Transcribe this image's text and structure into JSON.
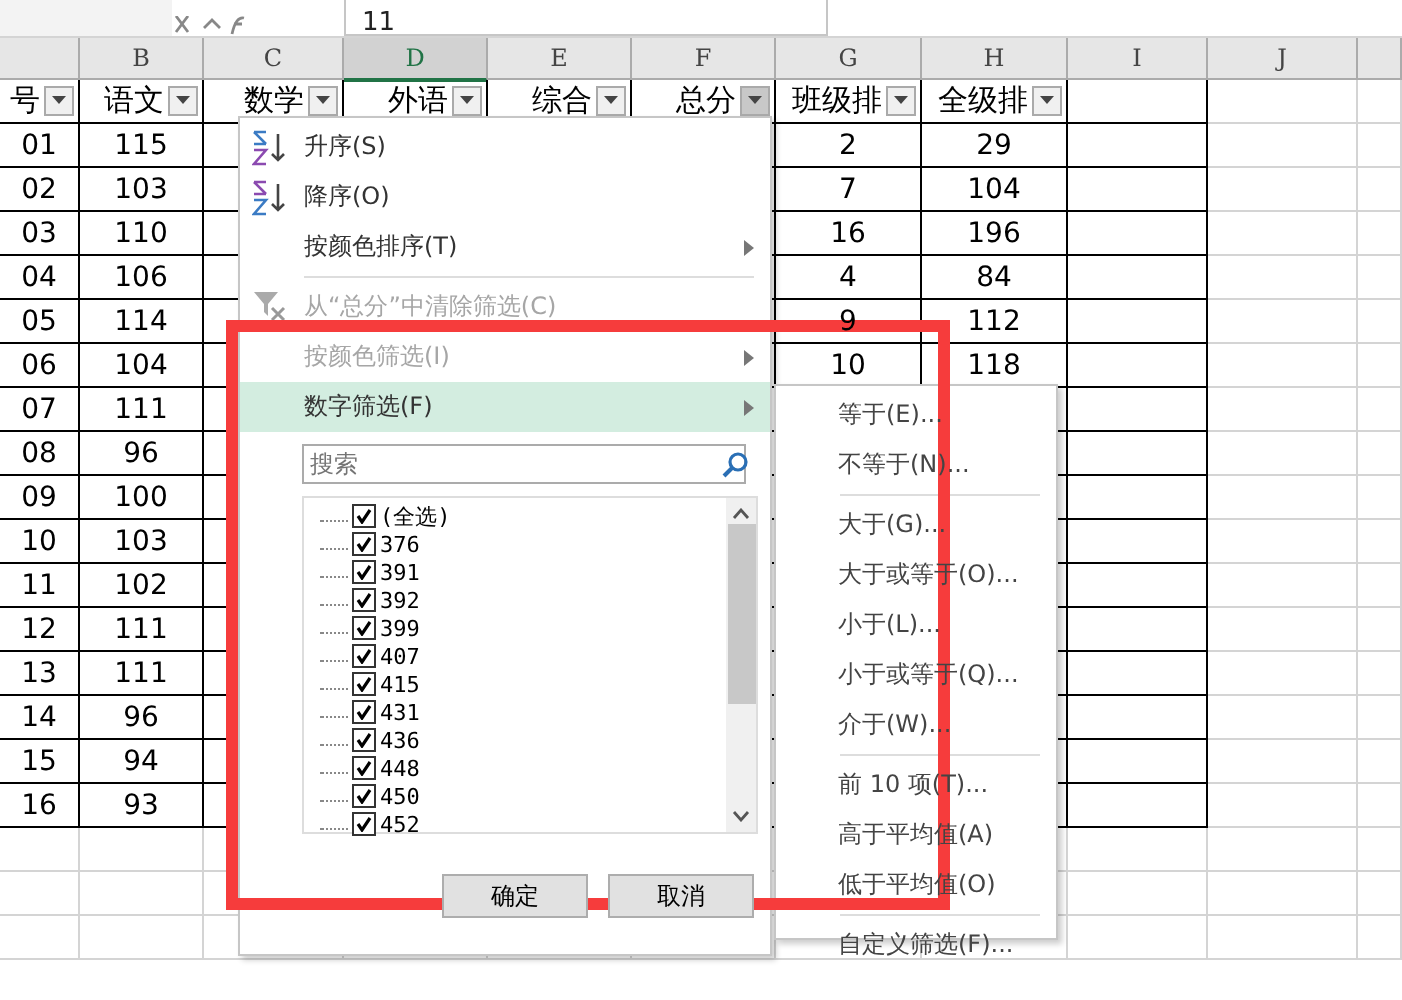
{
  "formula_bar": {
    "value": "11"
  },
  "columns": [
    {
      "selected": false
    },
    {
      "letter": "B",
      "selected": false
    },
    {
      "letter": "C",
      "selected": false
    },
    {
      "letter": "D",
      "selected": true
    },
    {
      "letter": "E",
      "selected": false
    },
    {
      "letter": "F",
      "selected": false
    },
    {
      "letter": "G",
      "selected": false
    },
    {
      "letter": "H",
      "selected": false
    },
    {
      "letter": "I",
      "selected": false
    },
    {
      "letter": "J",
      "selected": false
    }
  ],
  "headers": [
    {
      "label": "号",
      "filtered": false
    },
    {
      "label": "语文",
      "filtered": false
    },
    {
      "label": "数学",
      "filtered": false
    },
    {
      "label": "外语",
      "filtered": false
    },
    {
      "label": "综合",
      "filtered": false
    },
    {
      "label": "总分",
      "filtered": true
    },
    {
      "label": "班级排",
      "filtered": false
    },
    {
      "label": "全级排",
      "filtered": false
    }
  ],
  "rows": [
    {
      "a": "01",
      "b": "115",
      "g": "2",
      "h": "29"
    },
    {
      "a": "02",
      "b": "103",
      "g": "7",
      "h": "104"
    },
    {
      "a": "03",
      "b": "110",
      "g": "16",
      "h": "196"
    },
    {
      "a": "04",
      "b": "106",
      "g": "4",
      "h": "84"
    },
    {
      "a": "05",
      "b": "114",
      "g": "9",
      "h": "112"
    },
    {
      "a": "06",
      "b": "104",
      "g": "10",
      "h": "118"
    },
    {
      "a": "07",
      "b": "111"
    },
    {
      "a": "08",
      "b": "96"
    },
    {
      "a": "09",
      "b": "100"
    },
    {
      "a": "10",
      "b": "103"
    },
    {
      "a": "11",
      "b": "102"
    },
    {
      "a": "12",
      "b": "111"
    },
    {
      "a": "13",
      "b": "111"
    },
    {
      "a": "14",
      "b": "96"
    },
    {
      "a": "15",
      "b": "94"
    },
    {
      "a": "16",
      "b": "93"
    }
  ],
  "filter_menu": {
    "items": [
      {
        "kind": "sort-asc",
        "label": "升序(S)",
        "disabled": false,
        "submenu": false,
        "highlighted": false
      },
      {
        "kind": "sort-desc",
        "label": "降序(O)",
        "disabled": false,
        "submenu": false,
        "highlighted": false
      },
      {
        "kind": "plain",
        "label": "按颜色排序(T)",
        "disabled": false,
        "submenu": true,
        "highlighted": false
      },
      {
        "kind": "clear",
        "label": "从“总分”中清除筛选(C)",
        "disabled": true,
        "submenu": false,
        "highlighted": false
      },
      {
        "kind": "plain",
        "label": "按颜色筛选(I)",
        "disabled": true,
        "submenu": true,
        "highlighted": false
      },
      {
        "kind": "plain",
        "label": "数字筛选(F)",
        "disabled": false,
        "submenu": true,
        "highlighted": true
      }
    ],
    "search": {
      "placeholder": "搜索"
    },
    "values": [
      {
        "label": "(全选)",
        "checked": true
      },
      {
        "label": "376",
        "checked": true
      },
      {
        "label": "391",
        "checked": true
      },
      {
        "label": "392",
        "checked": true
      },
      {
        "label": "399",
        "checked": true
      },
      {
        "label": "407",
        "checked": true
      },
      {
        "label": "415",
        "checked": true
      },
      {
        "label": "431",
        "checked": true
      },
      {
        "label": "436",
        "checked": true
      },
      {
        "label": "448",
        "checked": true
      },
      {
        "label": "450",
        "checked": true
      },
      {
        "label": "452",
        "checked": true
      }
    ],
    "buttons": [
      "确定",
      "取消"
    ]
  },
  "number_filter_menu": {
    "groups": [
      [
        "等于(E)...",
        "不等于(N)..."
      ],
      [
        "大于(G)...",
        "大于或等于(O)...",
        "小于(L)...",
        "小于或等于(Q)...",
        "介于(W)..."
      ],
      [
        "前 10 项(T)...",
        "高于平均值(A)",
        "低于平均值(O)"
      ],
      [
        "自定义筛选(F)..."
      ]
    ]
  }
}
